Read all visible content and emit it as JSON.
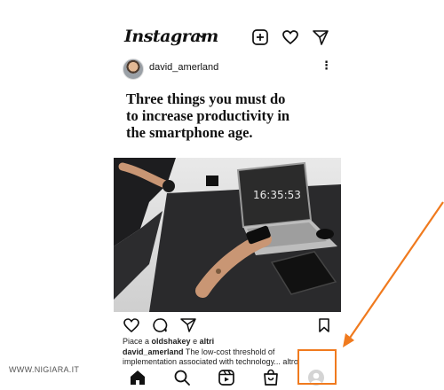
{
  "app": {
    "logo_text": "Instagram"
  },
  "post": {
    "username": "david_amerland",
    "more_label": "⋮",
    "headline_line1": "Three things you must do",
    "headline_line2": "to increase productivity in",
    "headline_line3": "the smartphone age.",
    "clock_text": "16:35:53",
    "likes_prefix": "Piace a ",
    "likes_user": "oldshakey",
    "likes_middle": " e ",
    "likes_others": "altri",
    "caption_user": "david_amerland",
    "caption_text": " The low-cost threshold of implementation associated with technology... altro"
  },
  "icons": {
    "top": [
      "new-post-icon",
      "heart-icon",
      "direct-message-icon"
    ],
    "actions": [
      "like-icon",
      "comment-icon",
      "share-icon",
      "save-icon"
    ],
    "nav": [
      "home-icon",
      "search-icon",
      "reels-icon",
      "shop-icon",
      "profile-icon"
    ]
  },
  "colors": {
    "highlight": "#f07a1e",
    "text": "#111111"
  },
  "watermark": "WWW.NIGIARA.IT"
}
